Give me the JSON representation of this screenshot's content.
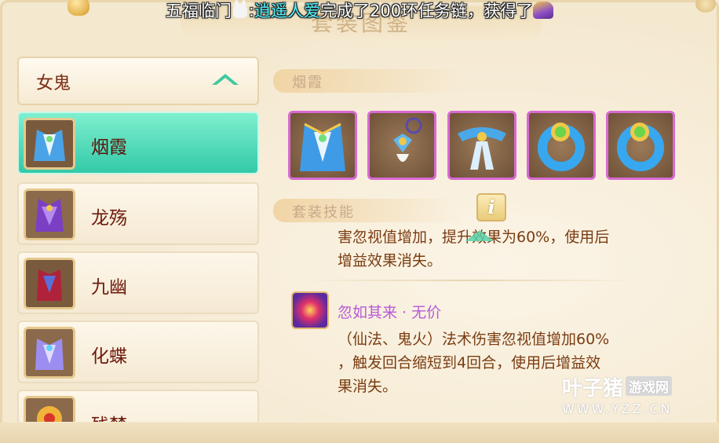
{
  "ticker": {
    "prefix": "五福临门",
    "colon": ":",
    "player": "逍遥人爱",
    "suffix": "完成了200环任务链，获得了"
  },
  "panel": {
    "title": "套装图鉴"
  },
  "dropdown": {
    "selected": "女鬼"
  },
  "sets": [
    {
      "name": "烟霞",
      "selected": true,
      "icon": "blue-cloak-icon"
    },
    {
      "name": "龙殇",
      "selected": false,
      "icon": "purple-armor-icon"
    },
    {
      "name": "九幽",
      "selected": false,
      "icon": "red-armor-icon"
    },
    {
      "name": "化蝶",
      "selected": false,
      "icon": "lavender-armor-icon"
    },
    {
      "name": "残梦",
      "selected": false,
      "icon": "gold-armor-icon"
    }
  ],
  "right": {
    "set_header": "烟霞",
    "skills_header": "套装技能",
    "info_label": "i",
    "equipment": [
      "cloak-icon",
      "pendant-icon",
      "belt-icon",
      "ring-icon",
      "ring-icon"
    ],
    "skill1_text": [
      "害忽视值增加，提升效果为60%，使用后",
      "增益效果消失。"
    ],
    "skill2_name": "忽如其来 · 无价",
    "skill2_text": [
      "（仙法、鬼火）法术伤害忽视值增加60%",
      "，触发回合缩短到4回合，使用后增益效",
      "果消失。"
    ]
  },
  "watermark": {
    "brand": "叶子猪",
    "tag": "游戏网",
    "url": "WWW.YZZ.CN"
  },
  "colors": {
    "accent_teal": "#33c9a8",
    "equip_border": "#d86ad2",
    "text_brown": "#7a3d12",
    "skill_name": "#b85ad6",
    "ticker_highlight": "#4ff4ff"
  }
}
